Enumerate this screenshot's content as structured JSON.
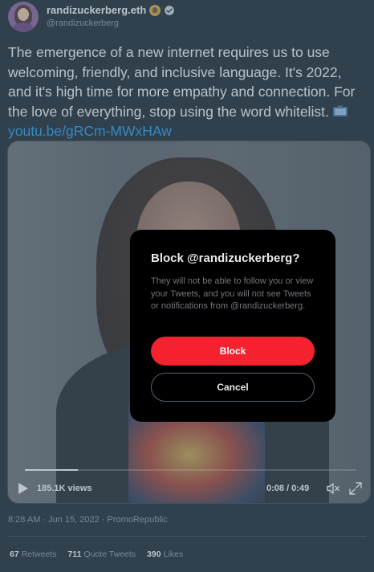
{
  "colors": {
    "background": "#15202b",
    "accent_link": "#1d9bf0",
    "block_button": "#f4212e",
    "modal_background": "#000000",
    "secondary_text": "#8b98a5"
  },
  "tweet": {
    "author": {
      "display_name": "randizuckerberg.eth",
      "handle": "@randizuckerberg",
      "badge_icon": "gold-emoji-badge-icon",
      "verified_icon": "verified-check-icon"
    },
    "text": "The emergence of a new internet requires us to use welcoming, friendly, and inclusive language. It's 2022, and it's high time for more empathy and connection. For the love of everything, stop using the word whitelist.",
    "link_text": "youtu.be/gRCm-MWxHAw",
    "emoji_icon": "television-icon",
    "video": {
      "views": "185.1K views",
      "time": "0:08 / 0:49",
      "progress_fraction": 0.16,
      "play_icon": "play-icon",
      "mute_icon": "mute-icon",
      "fullscreen_icon": "fullscreen-icon"
    },
    "timestamp": "8:28 AM · Jun 15, 2022 · PromoRepublic",
    "stats": {
      "retweets_count": "67",
      "retweets_label": "Retweets",
      "quotes_count": "711",
      "quotes_label": "Quote Tweets",
      "likes_count": "390",
      "likes_label": "Likes"
    }
  },
  "modal": {
    "title": "Block @randizuckerberg?",
    "body": "They will not be able to follow you or view your Tweets, and you will not see Tweets or notifications from @randizuckerberg.",
    "block_label": "Block",
    "cancel_label": "Cancel"
  }
}
